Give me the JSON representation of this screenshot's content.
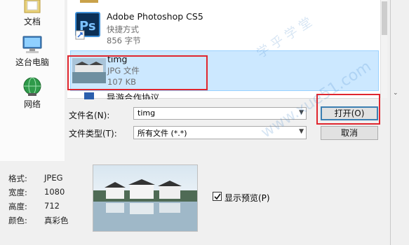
{
  "places": [
    {
      "label": "文档",
      "icon": "documents-folder-icon"
    },
    {
      "label": "这台电脑",
      "icon": "computer-icon"
    },
    {
      "label": "网络",
      "icon": "network-globe-icon"
    }
  ],
  "files": [
    {
      "name": "Adobe Photoshop CS5",
      "type": "快捷方式",
      "size": "856 字节",
      "icon": "photoshop-shortcut-icon",
      "selected": false
    },
    {
      "name": "timg",
      "type": "JPG 文件",
      "size": "107 KB",
      "icon": "image-thumbnail-icon",
      "selected": true
    },
    {
      "name": "导游合作协议",
      "icon": "document-icon",
      "selected": false
    }
  ],
  "form": {
    "filename_label": "文件名(N):",
    "filename_value": "timg",
    "filetype_label": "文件类型(T):",
    "filetype_value": "所有文件 (*.*)",
    "open_label": "打开(O)",
    "cancel_label": "取消"
  },
  "info": {
    "format_label": "格式:",
    "format_value": "JPEG",
    "width_label": "宽度:",
    "width_value": "1080",
    "height_label": "高度:",
    "height_value": "712",
    "color_label": "颜色:",
    "color_value": "真彩色"
  },
  "preview_label": "显示预览(P)",
  "preview_checked": true,
  "watermarks": [
    "www.xue51.com",
    "学 乎 学 堂"
  ]
}
